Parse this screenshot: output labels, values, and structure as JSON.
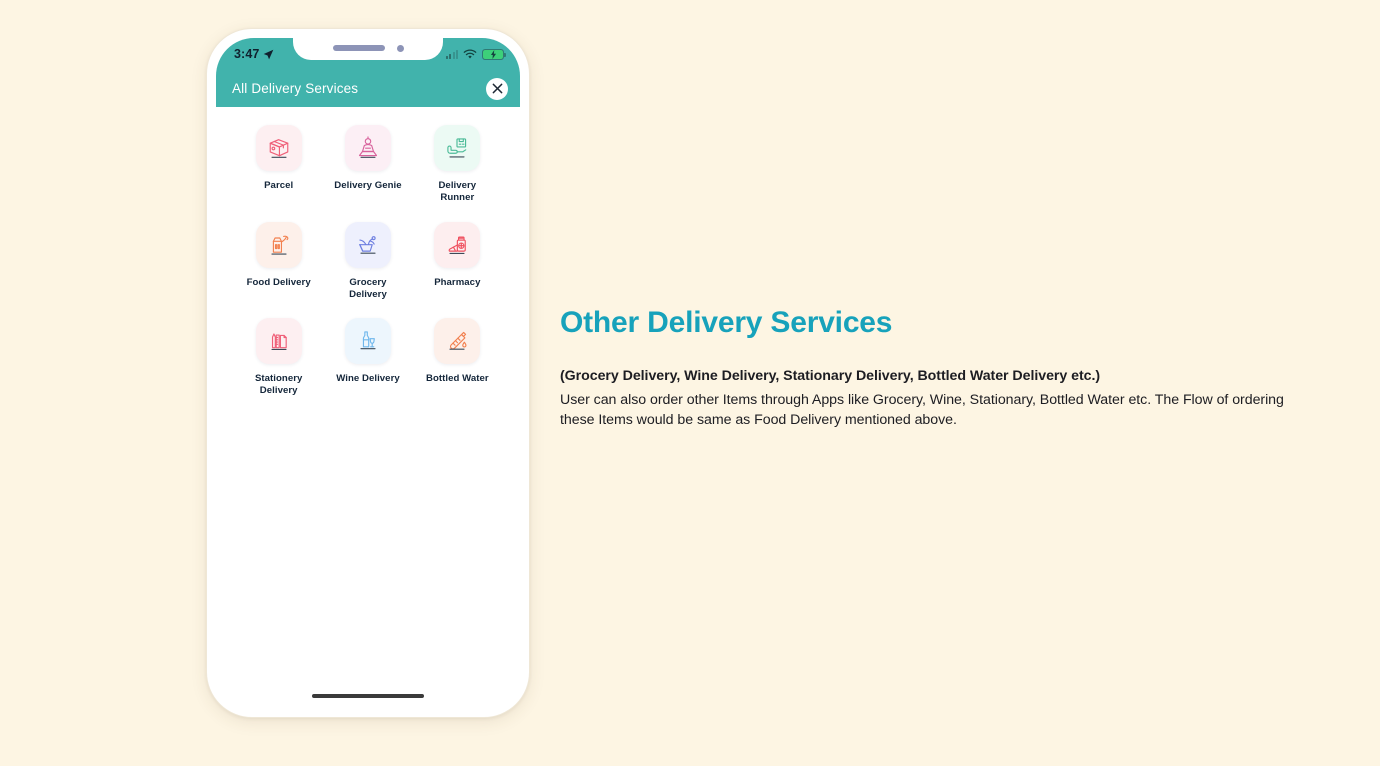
{
  "theme": {
    "background": "#fdf5e3",
    "teal_header": "#41b3ac",
    "heading_accent": "#17a2bb",
    "label_color": "#14263a"
  },
  "phone": {
    "statusbar": {
      "time": "3:47",
      "location_icon": "location-arrow-icon",
      "signal_icon": "cellular-signal-icon",
      "wifi_icon": "wifi-icon",
      "battery_icon": "battery-charging-icon"
    },
    "appbar": {
      "title": "All Delivery Services",
      "close_icon": "close-icon"
    },
    "services": [
      {
        "label": "Parcel",
        "icon": "parcel-box-icon",
        "color": "#ef5f78",
        "tint": "#fdeff1"
      },
      {
        "label": "Delivery Genie",
        "icon": "genie-lamp-icon",
        "color": "#d8629c",
        "tint": "#fceff5"
      },
      {
        "label": "Delivery\nRunner",
        "icon": "hand-package-icon",
        "color": "#4cbb98",
        "tint": "#ecfaf4"
      },
      {
        "label": "Food Delivery",
        "icon": "food-bag-icon",
        "color": "#f2804f",
        "tint": "#fdf0ea"
      },
      {
        "label": "Grocery\nDelivery",
        "icon": "grocery-basket-icon",
        "color": "#6d7ee0",
        "tint": "#eef0fd"
      },
      {
        "label": "Pharmacy",
        "icon": "medicine-bottle-icon",
        "color": "#ef4f5e",
        "tint": "#fdeeef"
      },
      {
        "label": "Stationery\nDelivery",
        "icon": "stationery-icon",
        "color": "#ef5f78",
        "tint": "#fdeff1"
      },
      {
        "label": "Wine Delivery",
        "icon": "wine-bottle-icon",
        "color": "#6fb7ec",
        "tint": "#edf6fd"
      },
      {
        "label": "Bottled Water",
        "icon": "water-bottle-icon",
        "color": "#f2804f",
        "tint": "#fdf0ea"
      }
    ],
    "home_indicator": "home-indicator"
  },
  "panel": {
    "title": "Other Delivery Services",
    "subtitle": "(Grocery Delivery, Wine Delivery, Stationary Delivery, Bottled Water Delivery etc.)",
    "body": "User can also order other Items through Apps like Grocery, Wine, Stationary, Bottled Water etc. The Flow of ordering these Items would be same as Food Delivery mentioned above."
  }
}
